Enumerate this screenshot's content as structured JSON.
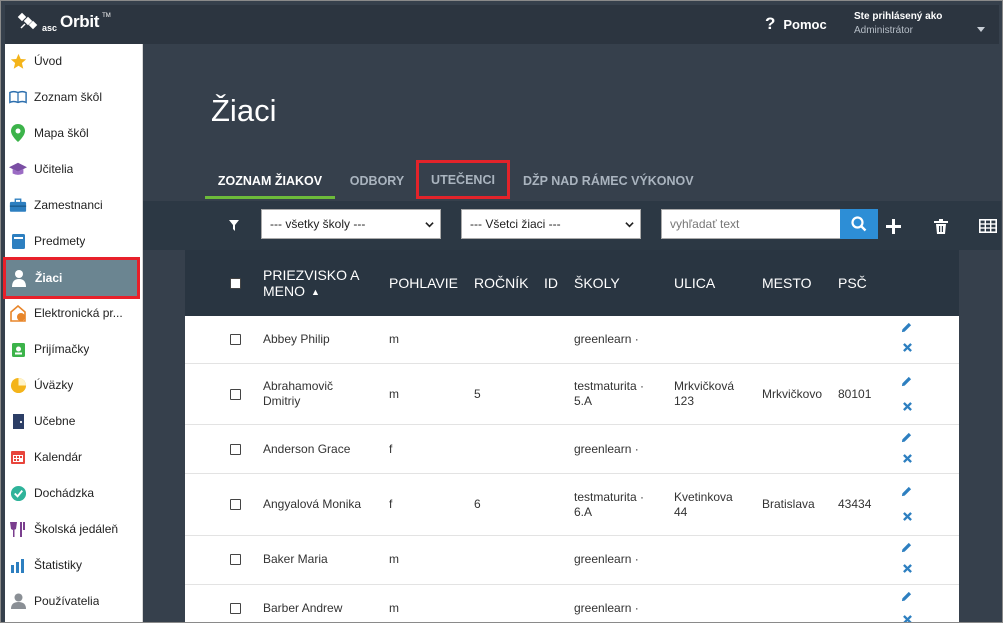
{
  "app": {
    "logo_asc": "asc",
    "logo_orbit": "Orbit",
    "logo_tm": "TM"
  },
  "header": {
    "help_icon": "question-icon",
    "help_label": "Pomoc",
    "user_line1": "Ste prihlásený ako",
    "user_line2": "Administrátor"
  },
  "sidebar": {
    "items": [
      {
        "label": "Úvod",
        "icon": "star-icon",
        "color": "#f4b41a"
      },
      {
        "label": "Zoznam škôl",
        "icon": "book-icon",
        "color": "#2d6fae"
      },
      {
        "label": "Mapa škôl",
        "icon": "map-pin-icon",
        "color": "#3cb34a"
      },
      {
        "label": "Učitelia",
        "icon": "graduation-cap-icon",
        "color": "#7a4ea3"
      },
      {
        "label": "Zamestnanci",
        "icon": "briefcase-icon",
        "color": "#2d7fc0"
      },
      {
        "label": "Predmety",
        "icon": "notebook-icon",
        "color": "#2d7fc0"
      },
      {
        "label": "Žiaci",
        "icon": "student-icon",
        "color": "#ffffff",
        "active": true
      },
      {
        "label": "Elektronická pr...",
        "icon": "e-application-icon",
        "color": "#e8862a"
      },
      {
        "label": "Prijímačky",
        "icon": "admission-icon",
        "color": "#3cb34a"
      },
      {
        "label": "Úväzky",
        "icon": "pie-icon",
        "color": "#f4b41a"
      },
      {
        "label": "Učebne",
        "icon": "door-icon",
        "color": "#2c3e66"
      },
      {
        "label": "Kalendár",
        "icon": "calendar-icon",
        "color": "#e8453c"
      },
      {
        "label": "Dochádzka",
        "icon": "check-circle-icon",
        "color": "#2fb39a"
      },
      {
        "label": "Školská jedáleň",
        "icon": "dining-icon",
        "color": "#7a3e8e"
      },
      {
        "label": "Štatistiky",
        "icon": "bar-stats-icon",
        "color": "#2d7fc0"
      },
      {
        "label": "Používatelia",
        "icon": "user-icon",
        "color": "#8a8f95"
      }
    ]
  },
  "main": {
    "title": "Žiaci",
    "tabs": [
      {
        "label": "ZOZNAM ŽIAKOV",
        "active": true
      },
      {
        "label": "ODBORY"
      },
      {
        "label": "UTEČENCI",
        "highlighted": true
      },
      {
        "label": "DŽP NAD RÁMEC VÝKONOV"
      }
    ],
    "toolbar": {
      "filter_icon": "filter-icon",
      "school_select": "--- všetky školy ---",
      "student_select": "--- Všetci žiaci ---",
      "search_placeholder": "vyhľadať text",
      "search_icon": "search-icon",
      "add_icon": "plus-icon",
      "delete_icon": "trash-icon",
      "grid_icon": "grid-icon"
    },
    "table": {
      "columns": {
        "name": "PRIEZVISKO A MENO",
        "gender": "POHLAVIE",
        "year": "ROČNÍK",
        "id": "ID",
        "school": "ŠKOLY",
        "street": "ULICA",
        "city": "MESTO",
        "zip": "PSČ"
      },
      "sort_indicator": "▲",
      "rows": [
        {
          "name": "Abbey Philip",
          "gender": "m",
          "year": "",
          "id": "",
          "school": "greenlearn ·",
          "street": "",
          "city": "",
          "zip": ""
        },
        {
          "name": "Abrahamovič Dmitriy",
          "gender": "m",
          "year": "5",
          "id": "",
          "school": "testmaturita · 5.A",
          "street": "Mrkvičková 123",
          "city": "Mrkvičkovo",
          "zip": "80101"
        },
        {
          "name": "Anderson Grace",
          "gender": "f",
          "year": "",
          "id": "",
          "school": "greenlearn ·",
          "street": "",
          "city": "",
          "zip": ""
        },
        {
          "name": "Angyalová Monika",
          "gender": "f",
          "year": "6",
          "id": "",
          "school": "testmaturita · 6.A",
          "street": "Kvetinkova 44",
          "city": "Bratislava",
          "zip": "43434"
        },
        {
          "name": "Baker Maria",
          "gender": "m",
          "year": "",
          "id": "",
          "school": "greenlearn ·",
          "street": "",
          "city": "",
          "zip": ""
        },
        {
          "name": "Barber Andrew",
          "gender": "m",
          "year": "",
          "id": "",
          "school": "greenlearn ·",
          "street": "",
          "city": "",
          "zip": ""
        }
      ]
    }
  },
  "colors": {
    "accent_blue": "#2d8ed6",
    "tab_active_underline": "#6dbb3a",
    "highlight_red": "#e3232a",
    "edit_blue": "#2d7fc0"
  }
}
